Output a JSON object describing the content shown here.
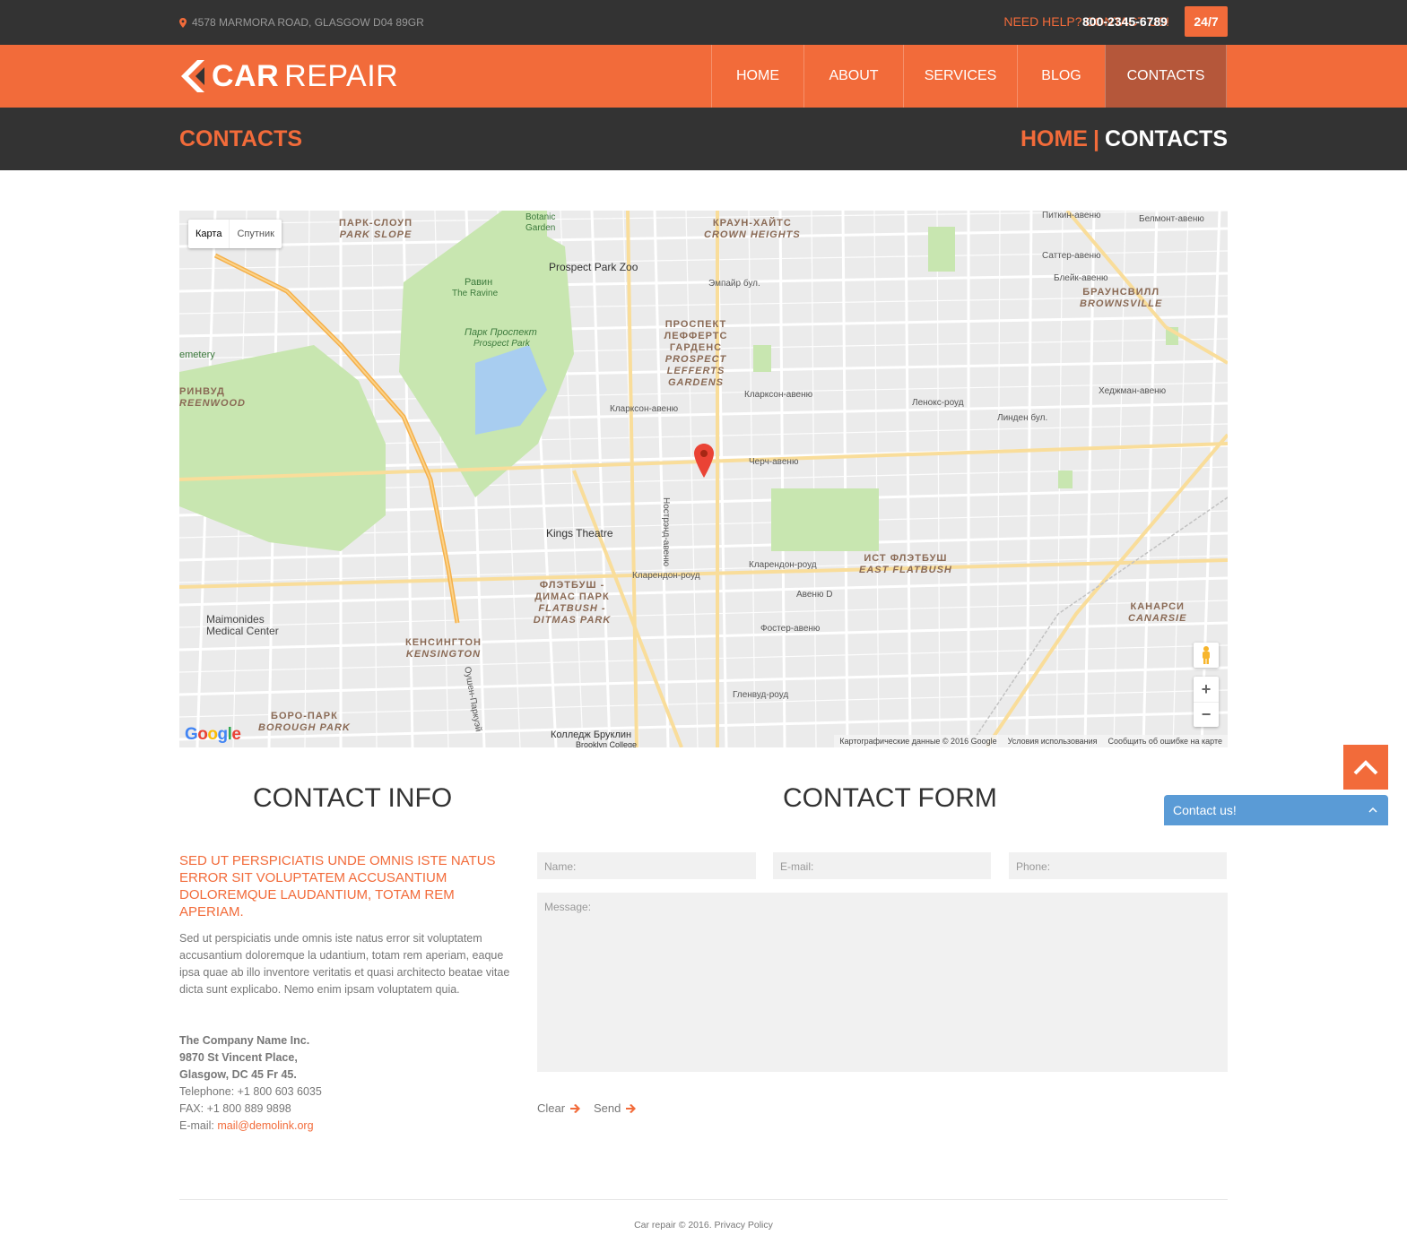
{
  "topbar": {
    "address": "4578 MARMORA ROAD, GLASGOW D04 89GR",
    "help": "NEED HELP? CONTACT US!",
    "phone": "800-2345-6789",
    "badge": "24/7"
  },
  "logo": {
    "part_bold": "CAR",
    "part_light": "REPAIR"
  },
  "nav": [
    {
      "label": "HOME"
    },
    {
      "label": "ABOUT"
    },
    {
      "label": "SERVICES"
    },
    {
      "label": "BLOG"
    },
    {
      "label": "CONTACTS"
    }
  ],
  "title": {
    "page": "CONTACTS",
    "crumb_home": "HOME",
    "crumb_sep": "|",
    "crumb_current": "CONTACTS"
  },
  "map": {
    "type_map": "Карта",
    "type_satellite": "Спутник",
    "zoom_in": "+",
    "zoom_out": "−",
    "google": "Google",
    "footer_data": "Картографические данные © 2016 Google",
    "footer_terms": "Условия использования",
    "footer_report": "Сообщить об ошибке на карте",
    "labels": {
      "park_slope_ru": "ПАРК-СЛОУП",
      "park_slope_en": "PARK SLOPE",
      "crown_ru": "КРАУН-ХАЙТС",
      "crown_en": "CROWN HEIGHTS",
      "lefferts_ru": "ПРОСПЕКТ ЛЕФФЕРТС ГАРДЕНС",
      "lefferts_en": "PROSPECT LEFFERTS GARDENS",
      "brownsville_ru": "БРАУНСВИЛЛ",
      "brownsville_en": "BROWNSVILLE",
      "greenwood_ru": "РИНВУД",
      "greenwood_en": "REENWOOD",
      "flatbush_ru": "ФЛЭТБУШ - ДИМАС ПАРК",
      "flatbush_en": "FLATBUSH - DITMAS PARK",
      "kensington_ru": "КЕНСИНГТОН",
      "kensington_en": "KENSINGTON",
      "east_flatbush_ru": "ИСТ ФЛЭТБУШ",
      "east_flatbush_en": "EAST FLATBUSH",
      "canarsie_ru": "КАНАРСИ",
      "canarsie_en": "CANARSIE",
      "borough_ru": "БОРО-ПАРК",
      "borough_en": "BOROUGH PARK",
      "botanic": "Botanic Garden",
      "zoo": "Prospect Park Zoo",
      "ravine_ru": "Равин",
      "ravine_en": "The Ravine",
      "park_ru": "Парк Проспект",
      "park_en": "Prospect Park",
      "kings": "Kings Theatre",
      "maimonides": "Maimonides Medical Center",
      "cemetery": "emetery",
      "college_ru": "Колледж Бруклин",
      "college_en": "Brooklyn College",
      "emp": "Эмпайр бул.",
      "clarkson": "Кларксон-авеню",
      "church": "Черч-авеню",
      "clarendon": "Кларендон-роуд",
      "avenue_d": "Авеню D",
      "foster": "Фостер-авеню",
      "glenwood": "Гленвуд-роуд",
      "nostrand": "Нострэнд-авеню",
      "ocean_pkwy": "Оушен-Паркуэй",
      "hedgeman": "Хеджман-авеню",
      "linden": "Линден бул.",
      "lenox": "Ленокс-роуд",
      "sutter": "Саттер-авеню",
      "blake": "Блейк-авеню",
      "pitkin": "Питкин-авеню",
      "belmont": "Белмонт-авеню"
    }
  },
  "contact_info": {
    "heading": "CONTACT INFO",
    "title": "SED UT PERSPICIATIS UNDE OMNIS ISTE NATUS ERROR SIT VOLUPTATEM ACCUSANTIUM DOLOREMQUE LAUDANTIUM, TOTAM REM APERIAM.",
    "text": "Sed ut perspiciatis unde omnis iste natus error sit voluptatem accusantium doloremque la udantium, totam rem aperiam, eaque ipsa quae ab illo inventore veritatis et quasi architecto beatae vitae dicta sunt explicabo. Nemo enim ipsam voluptatem quia.",
    "company": "The Company Name Inc.",
    "street": "9870 St Vincent Place,",
    "city": "Glasgow, DC 45 Fr 45.",
    "telephone": "Telephone: +1 800 603 6035",
    "fax": "FAX: +1 800 889 9898",
    "email_label": "E-mail: ",
    "email": "mail@demolink.org"
  },
  "contact_form": {
    "heading": "CONTACT FORM",
    "name_placeholder": "Name:",
    "email_placeholder": "E-mail:",
    "phone_placeholder": "Phone:",
    "message_placeholder": "Message:",
    "clear": "Clear",
    "send": "Send"
  },
  "footer": {
    "text": "Car repair © 2016. Privacy Policy"
  },
  "widget": {
    "contact_us": "Contact us!"
  },
  "colors": {
    "accent": "#f26b3a",
    "dark": "#333333",
    "active_nav": "#b5573a",
    "widget": "#5a9bd6"
  }
}
